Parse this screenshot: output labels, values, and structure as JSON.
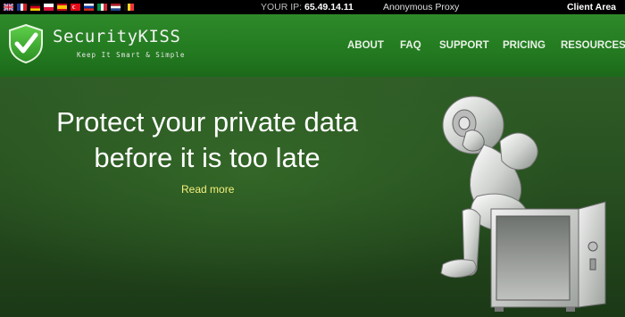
{
  "topbar": {
    "flags": [
      "uk-flag",
      "france-flag",
      "germany-flag",
      "poland-flag",
      "spain-flag",
      "turkey-flag",
      "russia-flag",
      "italy-flag",
      "netherlands-flag",
      "belgium-flag"
    ],
    "ip_label": "YOUR IP:",
    "ip_value": "65.49.14.11",
    "proxy_status": "Anonymous Proxy",
    "client_area": "Client Area"
  },
  "header": {
    "brand": "SecurityKISS",
    "tagline": "Keep It Smart & Simple",
    "nav": [
      "ABOUT",
      "FAQ",
      "SUPPORT",
      "PRICING",
      "RESOURCES"
    ]
  },
  "hero": {
    "headline_line1": "Protect your private data",
    "headline_line2": "before it is too late",
    "read_more": "Read more",
    "illustration": "robot-with-safe"
  },
  "colors": {
    "header_green": "#2e8a2a",
    "hero_green": "#2f5d26",
    "read_more_yellow": "#f5f17c"
  }
}
